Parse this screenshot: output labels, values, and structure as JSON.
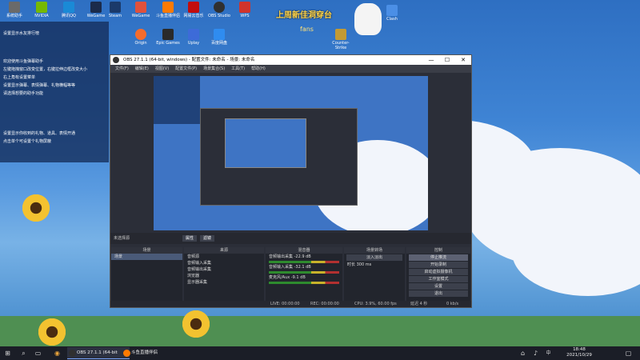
{
  "desktop": {
    "icons": [
      {
        "label": "系统助手",
        "color": "#6a6a6a"
      },
      {
        "label": "NVIDIA",
        "color": "#76b900"
      },
      {
        "label": "腾讯QQ",
        "color": "#1a8ad6"
      },
      {
        "label": "WeGame",
        "color": "#1b2b4b"
      },
      {
        "label": "Steam",
        "color": "#1b3a6a"
      },
      {
        "label": "WeGame",
        "color": "#e0513c"
      },
      {
        "label": "斗鱼直播伴侣",
        "color": "#ff7a00"
      },
      {
        "label": "网易云音乐",
        "color": "#c20c0c"
      },
      {
        "label": "OBS Studio",
        "color": "#303030"
      },
      {
        "label": "WPS",
        "color": "#d0342c"
      },
      {
        "label": "Origin",
        "color": "#f56c2d"
      },
      {
        "label": "Epic Games",
        "color": "#2a2a2a"
      },
      {
        "label": "Uplay",
        "color": "#3d6bd8"
      },
      {
        "label": "百度网盘",
        "color": "#2f8cf0"
      },
      {
        "label": "Counter-Strike",
        "color": "#c29a33"
      },
      {
        "label": "Clash",
        "color": "#4b8fe6"
      }
    ],
    "notification_lines": [
      "设置显示水友排行榜",
      "欢迎使用斗鱼弹幕助手",
      "左键拖拽窗口改变位置，右键拉伸边框改变大小",
      "右上角有设置菜单",
      "设置显示弹幕、表情弹幕、礼物横幅等等",
      "请选择想要的助手功能",
      "设置显示你收到的礼物、道具、表情开通",
      "点击单个可设置个礼物屏蔽"
    ],
    "banner_title": "上周新佳洞穿台",
    "banner_sub": "fans"
  },
  "obs": {
    "title": "OBS 27.1.1 (64-bit, windows) - 配置文件: 未命名 - 场景: 未命名",
    "window_controls": [
      "—",
      "☐",
      "✕"
    ],
    "menu": [
      "文件(F)",
      "编辑(E)",
      "视图(V)",
      "配置文件(P)",
      "场景集合(S)",
      "工具(T)",
      "帮助(H)"
    ],
    "panel_bar": [
      "未选择源",
      "属性",
      "滤镜"
    ],
    "docks": {
      "scenes": {
        "title": "场景",
        "items": [
          "场景"
        ]
      },
      "sources": {
        "title": "来源",
        "items": [
          "音频源",
          "音频输入采集",
          "音频输出采集",
          "浏览器",
          "显示器采集"
        ]
      },
      "mixer": {
        "title": "混音器",
        "channels": [
          {
            "name": "音频输出采集",
            "db": "-22.9 dB"
          },
          {
            "name": "音频输入采集",
            "db": "-32.1 dB"
          },
          {
            "name": "麦克风/Aux",
            "db": "-9.1 dB"
          }
        ]
      },
      "transitions": {
        "title": "场景转场",
        "type": "淡入淡出",
        "duration_label": "时长",
        "duration": "300 ms"
      },
      "controls": {
        "title": "控制",
        "buttons": [
          "停止推流",
          "开始录制",
          "启动虚拟摄像机",
          "工作室模式",
          "设置",
          "退出"
        ]
      }
    },
    "status": {
      "live": "LIVE: 00:00:00",
      "rec": "REC: 00:00:00",
      "cpu": "CPU: 3.9%, 60.00 fps",
      "fps": "延迟 4 秒",
      "bitrate": "0 kb/s"
    }
  },
  "taskbar": {
    "tasks": [
      {
        "label": "OBS 27.1.1 (64-bit",
        "color": "#303030"
      },
      {
        "label": "斗鱼直播伴侣",
        "color": "#ff7a00"
      }
    ],
    "time": "18:48",
    "date": "2021/10/29",
    "tray_icons": [
      "network-icon",
      "volume-icon",
      "ime-icon"
    ],
    "ime": "中"
  }
}
